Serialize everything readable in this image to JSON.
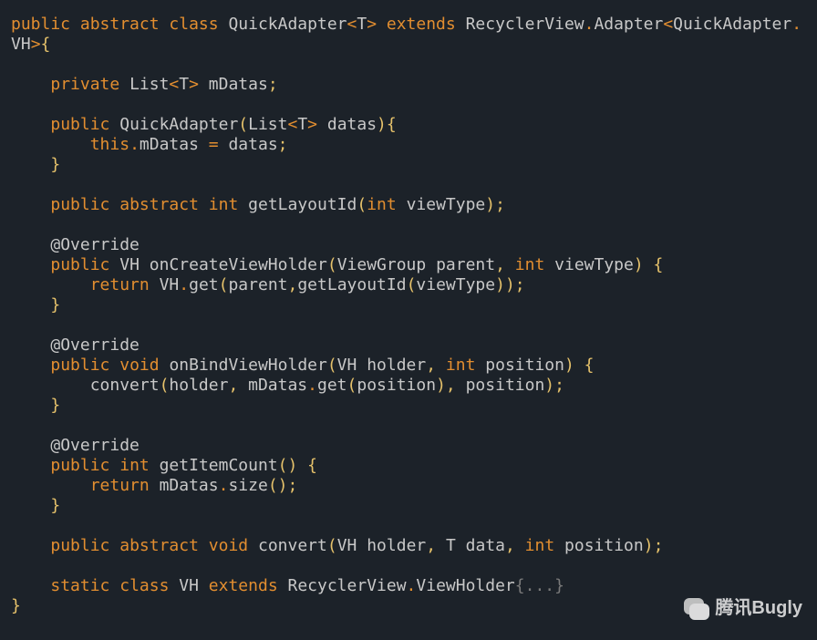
{
  "code": {
    "line1": {
      "t1": "public",
      "t2": "abstract",
      "t3": "class",
      "t4": "QuickAdapter",
      "t5": "<",
      "t6": "T",
      "t7": ">",
      "t8": "extends",
      "t9": "RecyclerView",
      "t10": ".",
      "t11": "Adapter",
      "t12": "<",
      "t13": "QuickAdapter",
      "t14": "."
    },
    "line2": {
      "t1": "VH",
      "t2": ">",
      "t3": "{"
    },
    "line3": {
      "t1": "private",
      "t2": "List",
      "t3": "<",
      "t4": "T",
      "t5": ">",
      "t6": "mDatas",
      "t7": ";"
    },
    "line4": {
      "t1": "public",
      "t2": "QuickAdapter",
      "t3": "(",
      "t4": "List",
      "t5": "<",
      "t6": "T",
      "t7": ">",
      "t8": "datas",
      "t9": ")",
      "t10": "{"
    },
    "line5": {
      "t1": "this",
      "t2": ".",
      "t3": "mDatas",
      "t4": "=",
      "t5": "datas",
      "t6": ";"
    },
    "line6": {
      "t1": "}"
    },
    "line7": {
      "t1": "public",
      "t2": "abstract",
      "t3": "int",
      "t4": "getLayoutId",
      "t5": "(",
      "t6": "int",
      "t7": "viewType",
      "t8": ")",
      "t9": ";"
    },
    "line8": {
      "t1": "@Override"
    },
    "line9": {
      "t1": "public",
      "t2": "VH",
      "t3": "onCreateViewHolder",
      "t4": "(",
      "t5": "ViewGroup",
      "t6": "parent",
      "t7": ",",
      "t8": "int",
      "t9": "viewType",
      "t10": ")",
      "t11": "{"
    },
    "line10": {
      "t1": "return",
      "t2": "VH",
      "t3": ".",
      "t4": "get",
      "t5": "(",
      "t6": "parent",
      "t7": ",",
      "t8": "getLayoutId",
      "t9": "(",
      "t10": "viewType",
      "t11": ")",
      "t12": ")",
      "t13": ";"
    },
    "line11": {
      "t1": "}"
    },
    "line12": {
      "t1": "@Override"
    },
    "line13": {
      "t1": "public",
      "t2": "void",
      "t3": "onBindViewHolder",
      "t4": "(",
      "t5": "VH",
      "t6": "holder",
      "t7": ",",
      "t8": "int",
      "t9": "position",
      "t10": ")",
      "t11": "{"
    },
    "line14": {
      "t1": "convert",
      "t2": "(",
      "t3": "holder",
      "t4": ",",
      "t5": "mDatas",
      "t6": ".",
      "t7": "get",
      "t8": "(",
      "t9": "position",
      "t10": ")",
      "t11": ",",
      "t12": "position",
      "t13": ")",
      "t14": ";"
    },
    "line15": {
      "t1": "}"
    },
    "line16": {
      "t1": "@Override"
    },
    "line17": {
      "t1": "public",
      "t2": "int",
      "t3": "getItemCount",
      "t4": "(",
      "t5": ")",
      "t6": "{"
    },
    "line18": {
      "t1": "return",
      "t2": "mDatas",
      "t3": ".",
      "t4": "size",
      "t5": "(",
      "t6": ")",
      "t7": ";"
    },
    "line19": {
      "t1": "}"
    },
    "line20": {
      "t1": "public",
      "t2": "abstract",
      "t3": "void",
      "t4": "convert",
      "t5": "(",
      "t6": "VH",
      "t7": "holder",
      "t8": ",",
      "t9": "T",
      "t10": "data",
      "t11": ",",
      "t12": "int",
      "t13": "position",
      "t14": ")",
      "t15": ";"
    },
    "line21": {
      "t1": "static",
      "t2": "class",
      "t3": "VH",
      "t4": "extends",
      "t5": "RecyclerView",
      "t6": ".",
      "t7": "ViewHolder",
      "t8": "{...}"
    },
    "line22": {
      "t1": "}"
    }
  },
  "watermark": {
    "text": "腾讯Bugly"
  }
}
